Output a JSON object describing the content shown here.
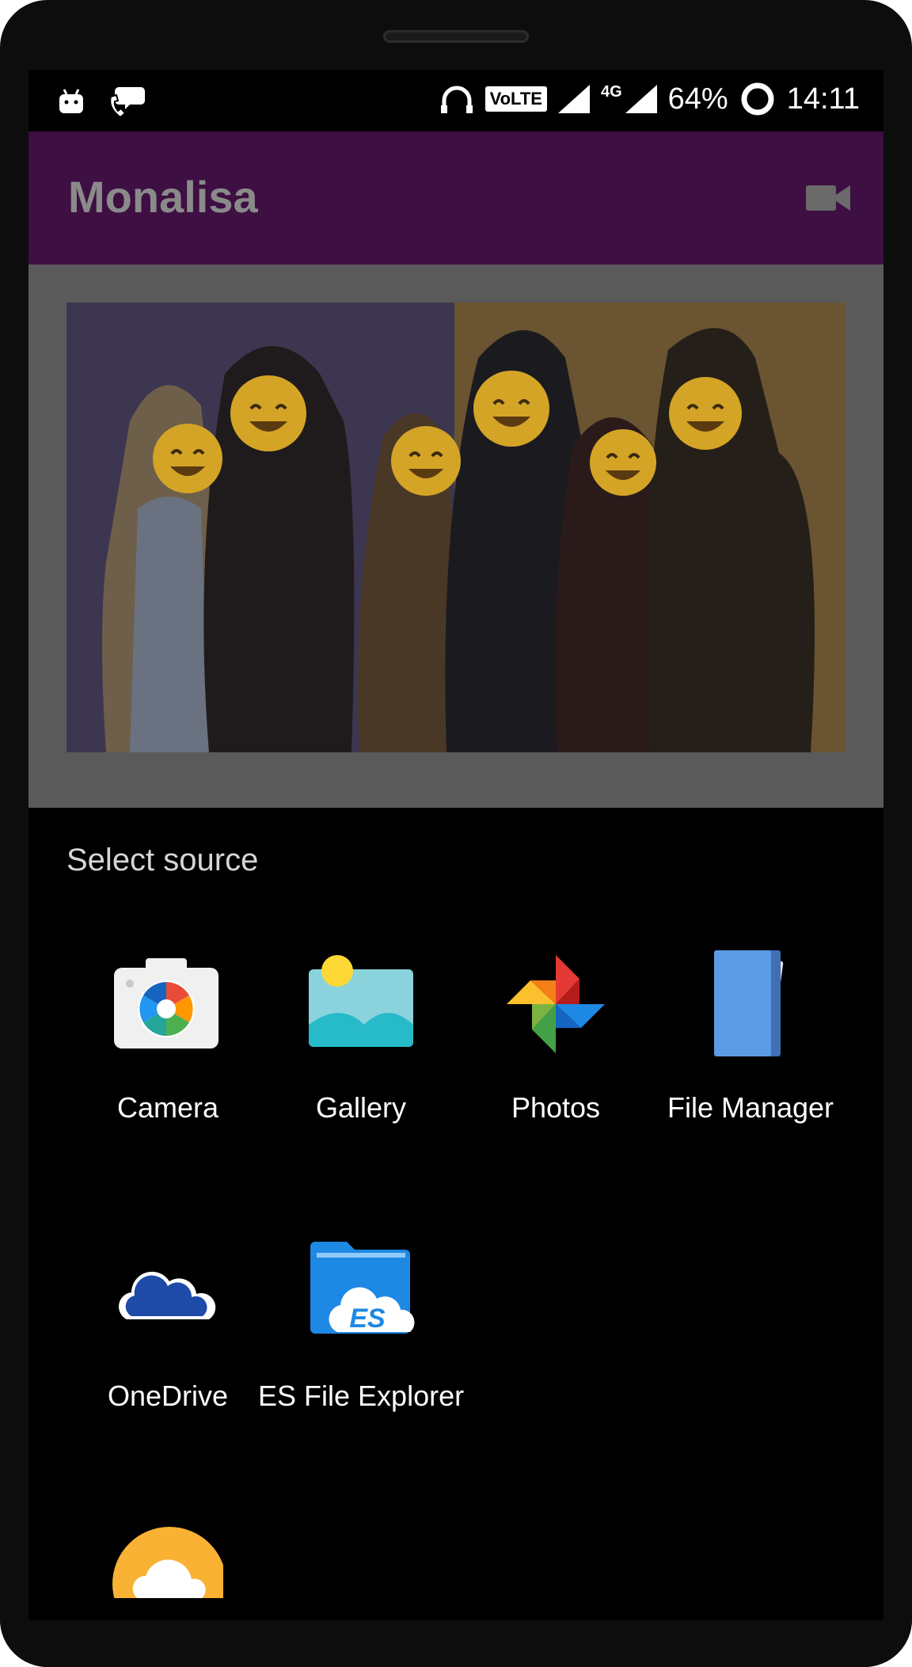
{
  "status_bar": {
    "battery": "64%",
    "time": "14:11",
    "volte": "VoLTE",
    "network": "4G"
  },
  "app_bar": {
    "title": "Monalisa",
    "action_icon": "video-camera-icon"
  },
  "sheet": {
    "title": "Select source",
    "apps": [
      {
        "label": "Camera",
        "icon": "camera-icon"
      },
      {
        "label": "Gallery",
        "icon": "gallery-icon"
      },
      {
        "label": "Photos",
        "icon": "photos-pinwheel-icon"
      },
      {
        "label": "File Manager",
        "icon": "file-manager-icon"
      },
      {
        "label": "OneDrive",
        "icon": "onedrive-cloud-icon"
      },
      {
        "label": "ES File Explorer",
        "icon": "es-file-explorer-icon"
      },
      {
        "label": "",
        "icon": "cloud-app-icon"
      }
    ]
  },
  "colors": {
    "app_bar": "#3e0f42",
    "scrim_content": "#5a5a5a",
    "sheet_background": "#000000"
  }
}
